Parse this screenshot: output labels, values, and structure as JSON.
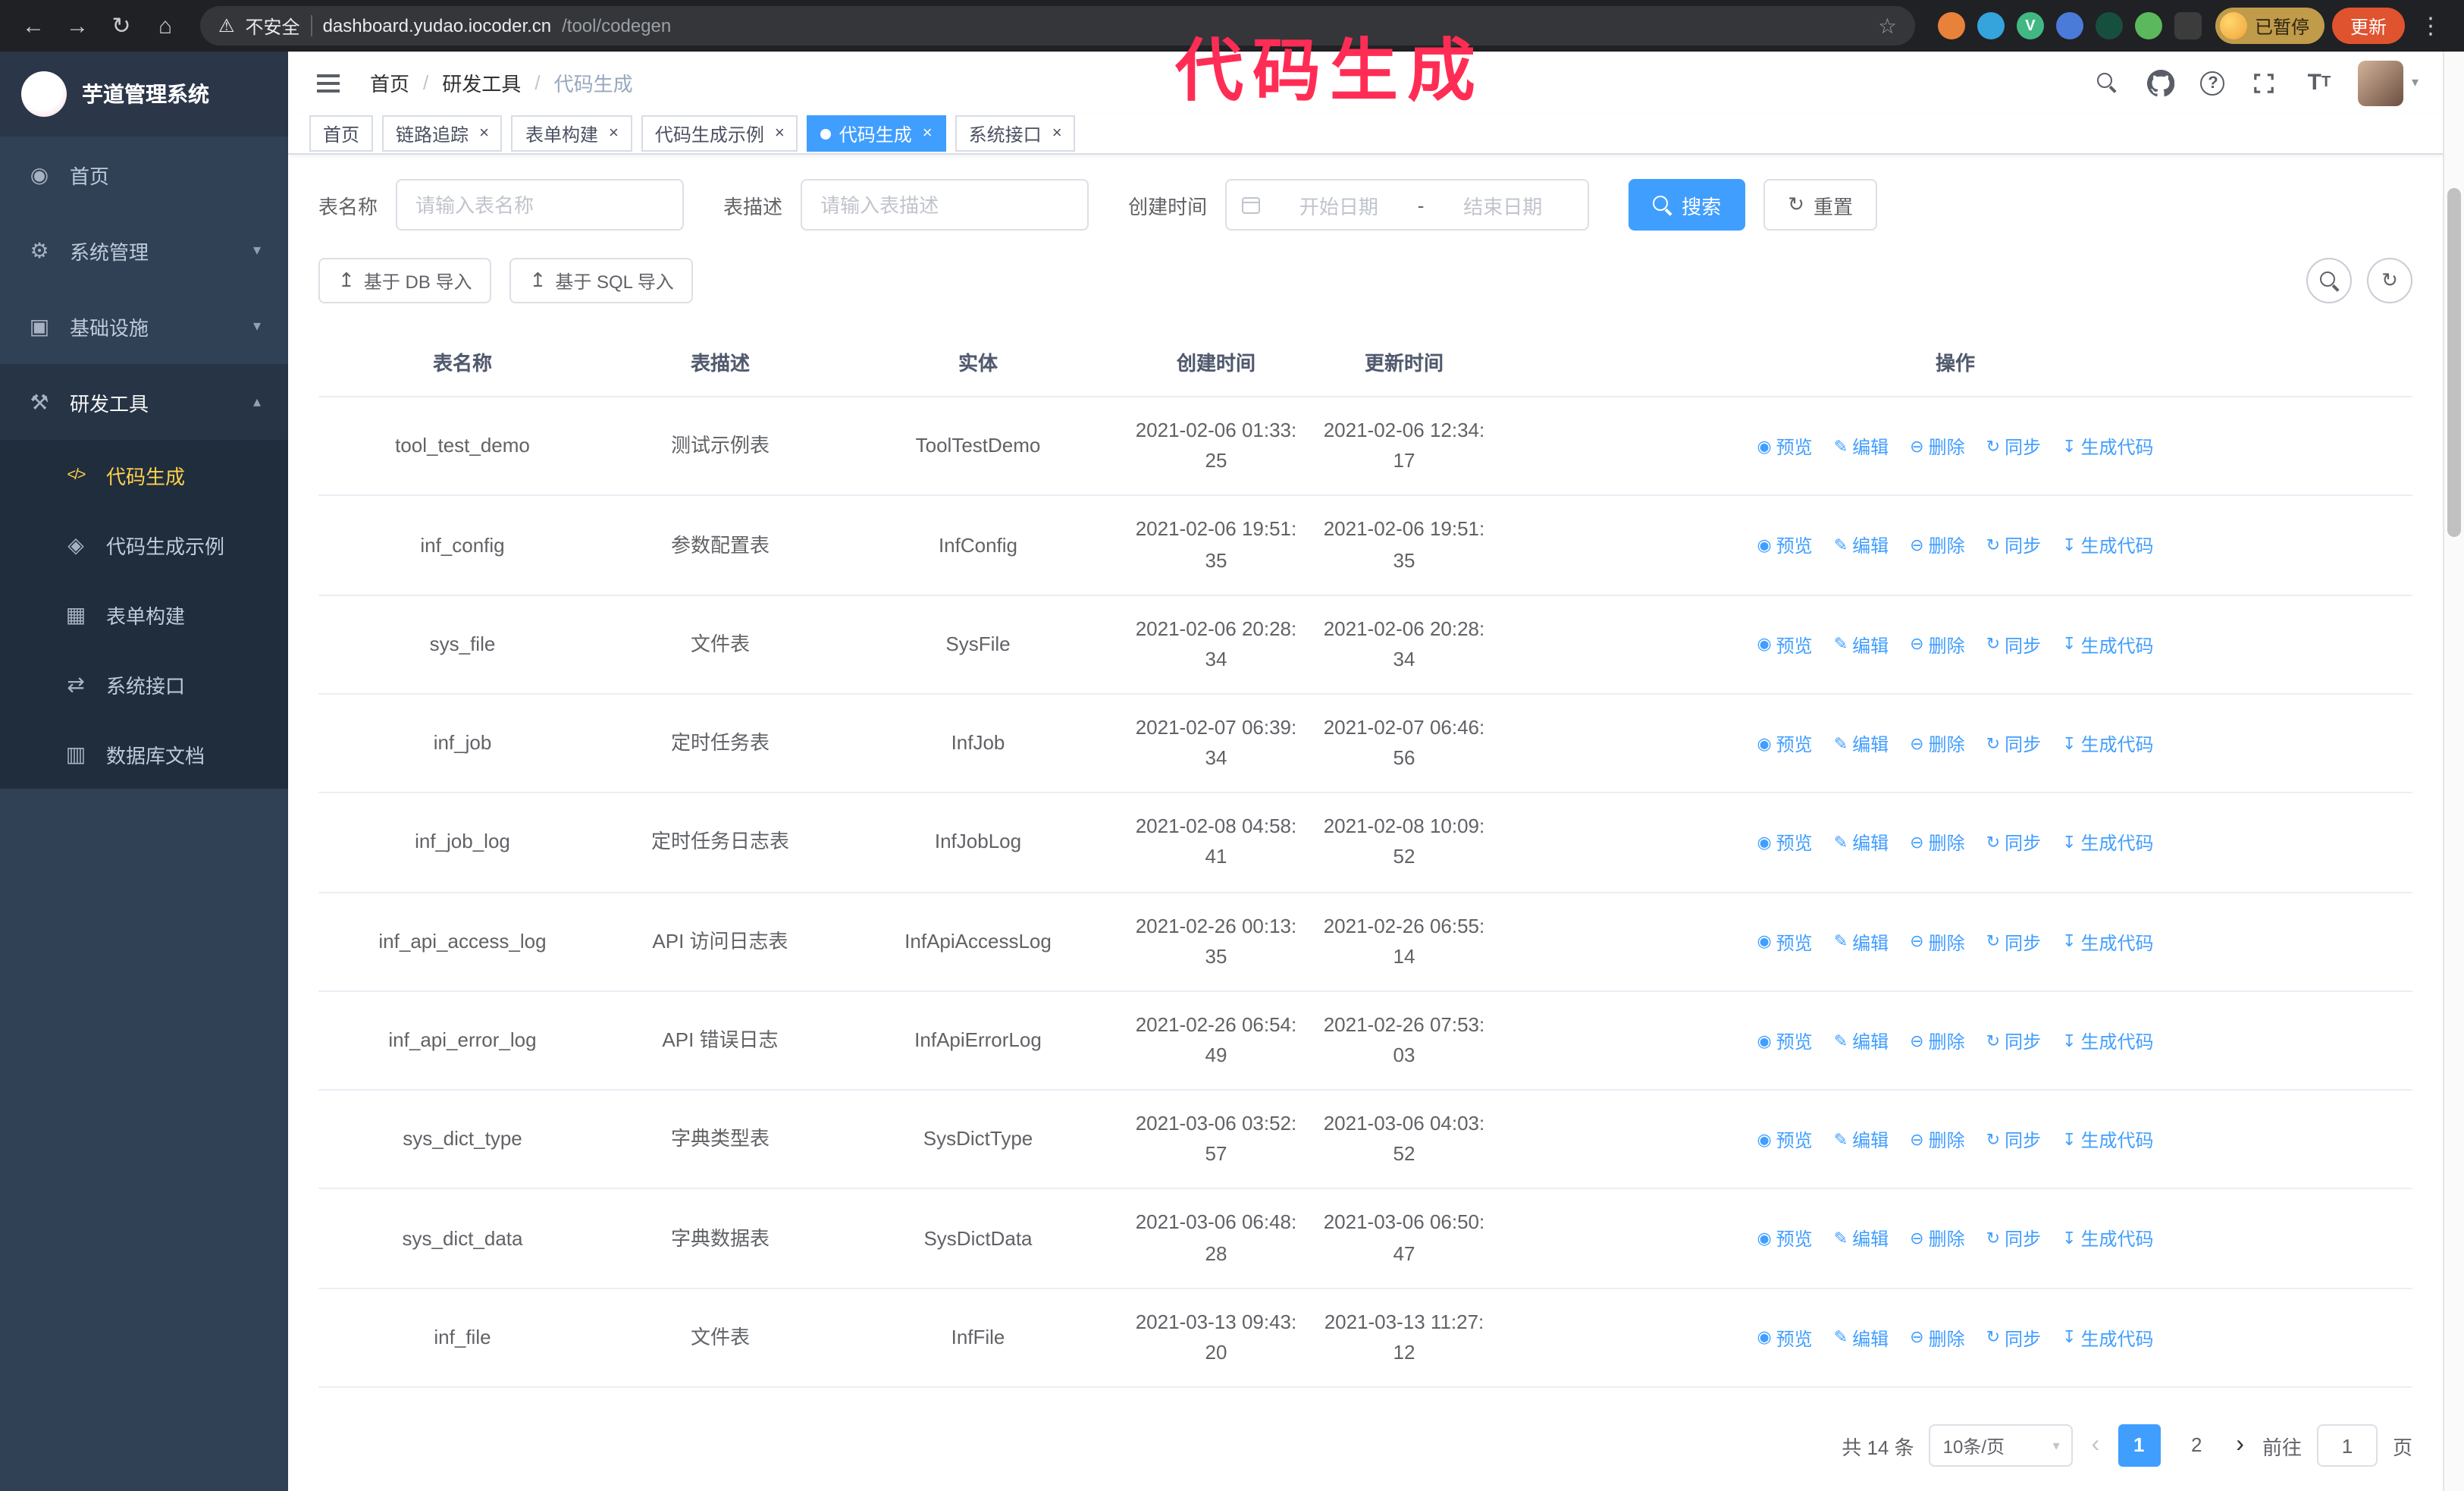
{
  "annotation": {
    "text": "代码生成"
  },
  "browser": {
    "security_text": "不安全",
    "url": {
      "host": "dashboard.yudao.iocoder.cn",
      "path": "/tool/codegen"
    },
    "profile_chip_label": "已暂停",
    "update_button_label": "更新",
    "extensions": [
      {
        "key": "fox",
        "color": "#e8823a"
      },
      {
        "key": "drop",
        "color": "#35a3dc"
      },
      {
        "key": "vue-devtools",
        "color": "#41b883",
        "glyph": "V"
      },
      {
        "key": "people-grid",
        "color": "#4a7bd8"
      },
      {
        "key": "screen",
        "color": "#174f3f"
      },
      {
        "key": "leaf",
        "color": "#5cb85c"
      },
      {
        "key": "puzzle",
        "color": "#3c3c3c"
      }
    ]
  },
  "sidebar": {
    "logo_title": "芋道管理系统",
    "items": [
      {
        "key": "home",
        "label": "首页",
        "icon": "dashboard",
        "has_children": false,
        "expanded": false
      },
      {
        "key": "system",
        "label": "系统管理",
        "icon": "gear",
        "has_children": true,
        "expanded": false
      },
      {
        "key": "infra",
        "label": "基础设施",
        "icon": "monitor",
        "has_children": true,
        "expanded": false
      },
      {
        "key": "devtools",
        "label": "研发工具",
        "icon": "tools",
        "has_children": true,
        "expanded": true,
        "children": [
          {
            "key": "codegen",
            "label": "代码生成",
            "icon": "code",
            "active": true
          },
          {
            "key": "codegen-example",
            "label": "代码生成示例",
            "icon": "example",
            "active": false
          },
          {
            "key": "form-build",
            "label": "表单构建",
            "icon": "form",
            "active": false
          },
          {
            "key": "api",
            "label": "系统接口",
            "icon": "api",
            "active": false
          },
          {
            "key": "db-doc",
            "label": "数据库文档",
            "icon": "db",
            "active": false
          }
        ]
      }
    ]
  },
  "header": {
    "breadcrumb": [
      {
        "key": "home",
        "label": "首页",
        "current": false
      },
      {
        "key": "devtools",
        "label": "研发工具",
        "current": false
      },
      {
        "key": "codegen",
        "label": "代码生成",
        "current": true
      }
    ]
  },
  "tabs": [
    {
      "key": "home",
      "label": "首页",
      "closable": false,
      "active": false
    },
    {
      "key": "tracer",
      "label": "链路追踪",
      "closable": true,
      "active": false
    },
    {
      "key": "form-build",
      "label": "表单构建",
      "closable": true,
      "active": false
    },
    {
      "key": "codegen-example",
      "label": "代码生成示例",
      "closable": true,
      "active": false
    },
    {
      "key": "codegen",
      "label": "代码生成",
      "closable": true,
      "active": true
    },
    {
      "key": "api",
      "label": "系统接口",
      "closable": true,
      "active": false
    }
  ],
  "filters": {
    "table_name_label": "表名称",
    "table_name_placeholder": "请输入表名称",
    "table_desc_label": "表描述",
    "table_desc_placeholder": "请输入表描述",
    "create_time_label": "创建时间",
    "date_start_placeholder": "开始日期",
    "date_separator": "-",
    "date_end_placeholder": "结束日期",
    "search_label": "搜索",
    "reset_label": "重置"
  },
  "toolbar": {
    "import_db_label": "基于 DB 导入",
    "import_sql_label": "基于 SQL 导入"
  },
  "table": {
    "columns": [
      "表名称",
      "表描述",
      "实体",
      "创建时间",
      "更新时间",
      "操作"
    ],
    "row_actions": [
      {
        "key": "preview",
        "label": "预览",
        "icon": "eye"
      },
      {
        "key": "edit",
        "label": "编辑",
        "icon": "edit"
      },
      {
        "key": "delete",
        "label": "删除",
        "icon": "delete"
      },
      {
        "key": "sync",
        "label": "同步",
        "icon": "sync"
      },
      {
        "key": "generate",
        "label": "生成代码",
        "icon": "download"
      }
    ],
    "rows": [
      {
        "name": "tool_test_demo",
        "desc": "测试示例表",
        "entity": "ToolTestDemo",
        "created": "2021-02-06 01:33:25",
        "updated": "2021-02-06 12:34:17"
      },
      {
        "name": "inf_config",
        "desc": "参数配置表",
        "entity": "InfConfig",
        "created": "2021-02-06 19:51:35",
        "updated": "2021-02-06 19:51:35"
      },
      {
        "name": "sys_file",
        "desc": "文件表",
        "entity": "SysFile",
        "created": "2021-02-06 20:28:34",
        "updated": "2021-02-06 20:28:34"
      },
      {
        "name": "inf_job",
        "desc": "定时任务表",
        "entity": "InfJob",
        "created": "2021-02-07 06:39:34",
        "updated": "2021-02-07 06:46:56"
      },
      {
        "name": "inf_job_log",
        "desc": "定时任务日志表",
        "entity": "InfJobLog",
        "created": "2021-02-08 04:58:41",
        "updated": "2021-02-08 10:09:52"
      },
      {
        "name": "inf_api_access_log",
        "desc": "API 访问日志表",
        "entity": "InfApiAccessLog",
        "created": "2021-02-26 00:13:35",
        "updated": "2021-02-26 06:55:14"
      },
      {
        "name": "inf_api_error_log",
        "desc": "API 错误日志",
        "entity": "InfApiErrorLog",
        "created": "2021-02-26 06:54:49",
        "updated": "2021-02-26 07:53:03"
      },
      {
        "name": "sys_dict_type",
        "desc": "字典类型表",
        "entity": "SysDictType",
        "created": "2021-03-06 03:52:57",
        "updated": "2021-03-06 04:03:52"
      },
      {
        "name": "sys_dict_data",
        "desc": "字典数据表",
        "entity": "SysDictData",
        "created": "2021-03-06 06:48:28",
        "updated": "2021-03-06 06:50:47"
      },
      {
        "name": "inf_file",
        "desc": "文件表",
        "entity": "InfFile",
        "created": "2021-03-13 09:43:20",
        "updated": "2021-03-13 11:27:12"
      }
    ]
  },
  "pagination": {
    "total_text": "共 14 条",
    "page_size": "10条/页",
    "pages": [
      "1",
      "2"
    ],
    "active_page": "1",
    "goto_label": "前往",
    "goto_value": "1",
    "goto_suffix": "页"
  },
  "colors": {
    "accent": "#409EFF",
    "sidebar_bg": "#304156",
    "submenu_bg": "#1f2d3d",
    "menu_active_text": "#ffd04b",
    "annotation": "#ff2d55",
    "update_button": "#e0532f"
  }
}
